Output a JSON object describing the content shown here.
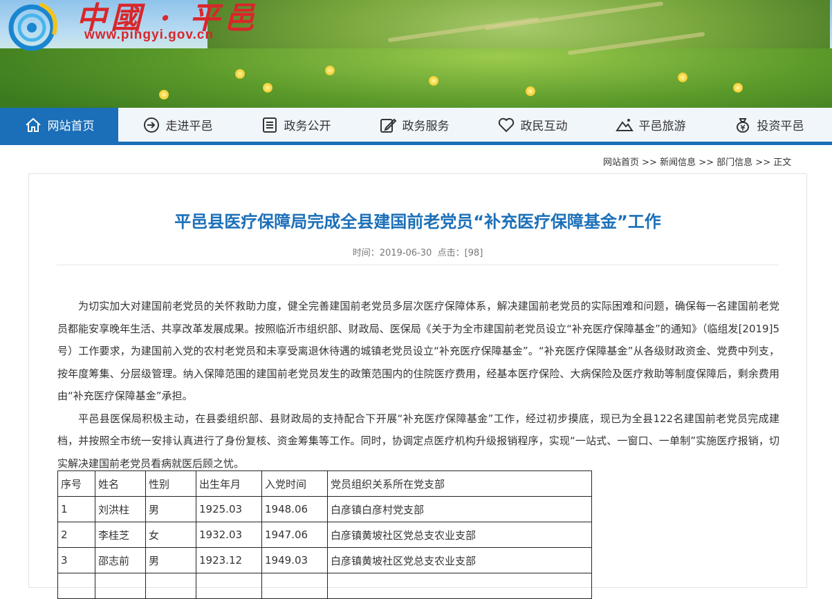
{
  "header": {
    "logo_title": "中國 · 平邑",
    "logo_url": "www.pingyi.gov.cn"
  },
  "nav": {
    "items": [
      {
        "label": "网站首页",
        "icon": "home-icon",
        "active": true
      },
      {
        "label": "走进平邑",
        "icon": "enter-arrow-icon",
        "active": false
      },
      {
        "label": "政务公开",
        "icon": "document-list-icon",
        "active": false
      },
      {
        "label": "政务服务",
        "icon": "edit-pen-icon",
        "active": false
      },
      {
        "label": "政民互动",
        "icon": "heart-icon",
        "active": false
      },
      {
        "label": "平邑旅游",
        "icon": "mountain-icon",
        "active": false
      },
      {
        "label": "投资平邑",
        "icon": "money-bag-icon",
        "active": false
      }
    ],
    "accent": "#1b6fb8"
  },
  "breadcrumb": {
    "home": "网站首页",
    "sep": " >> ",
    "news": "新闻信息",
    "dept": "部门信息",
    "current": "正文"
  },
  "article": {
    "title": "平邑县医疗保障局完成全县建国前老党员“补充医疗保障基金”工作",
    "time_label": "时间：",
    "time": "2019-06-30",
    "clicks_label": "点击：",
    "clicks": "[98]",
    "paragraphs": [
      "为切实加大对建国前老党员的关怀救助力度，健全完善建国前老党员多层次医疗保障体系，解决建国前老党员的实际困难和问题，确保每一名建国前老党员都能安享晚年生活、共享改革发展成果。按照临沂市组织部、财政局、医保局《关于为全市建国前老党员设立“补充医疗保障基金”的通知》（临组发[2019]5号）工作要求，为建国前入党的农村老党员和未享受离退休待遇的城镇老党员设立“补充医疗保障基金”。“补充医疗保障基金”从各级财政资金、党费中列支，按年度筹集、分层级管理。纳入保障范围的建国前老党员发生的政策范围内的住院医疗费用，经基本医疗保险、大病保险及医疗救助等制度保障后，剩余费用由“补充医疗保障基金”承担。",
      "平邑县医保局积极主动，在县委组织部、县财政局的支持配合下开展“补充医疗保障基金”工作，经过初步摸底，现已为全县122名建国前老党员完成建档，并按照全市统一安排认真进行了身份复核、资金筹集等工作。同时，协调定点医疗机构升级报销程序，实现“一站式、一窗口、一单制”实施医疗报销，切实解决建国前老党员看病就医后顾之忧。"
    ],
    "table": {
      "headers": [
        "序号",
        "姓名",
        "性别",
        "出生年月",
        "入党时间",
        "党员组织关系所在党支部"
      ],
      "rows": [
        [
          "1",
          "刘洪柱",
          "男",
          "1925.03",
          "1948.06",
          "白彦镇白彦村党支部"
        ],
        [
          "2",
          "李桂芝",
          "女",
          "1932.03",
          "1947.06",
          "白彦镇黄坡社区党总支农业支部"
        ],
        [
          "3",
          "邵志前",
          "男",
          "1923.12",
          "1949.03",
          "白彦镇黄坡社区党总支农业支部"
        ],
        [
          "",
          "",
          "",
          "",
          "",
          ""
        ]
      ]
    }
  }
}
